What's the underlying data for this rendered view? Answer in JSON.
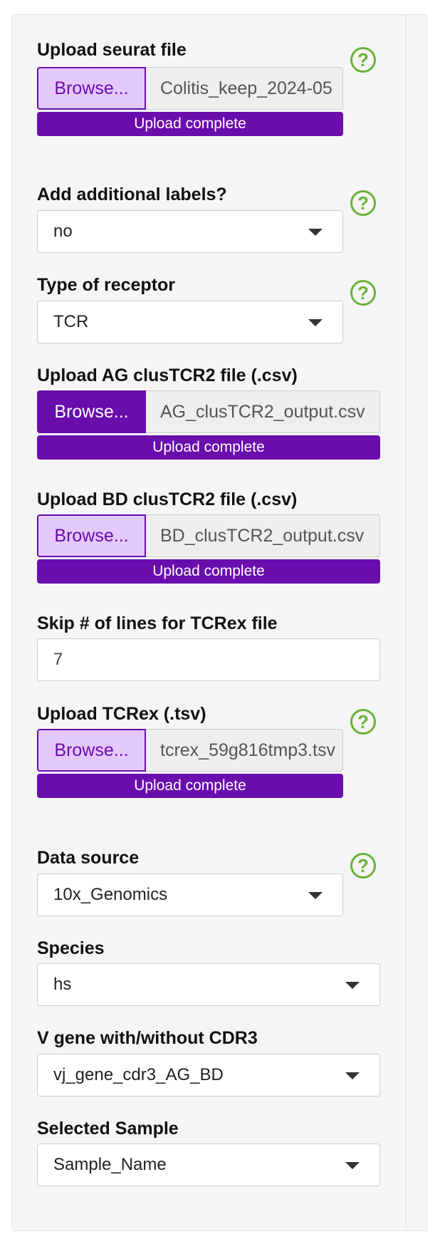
{
  "seurat": {
    "label": "Upload seurat file",
    "browse_label": "Browse...",
    "filename": "Colitis_keep_2024-05",
    "status": "Upload complete",
    "help": "?"
  },
  "additional_labels": {
    "label": "Add additional labels?",
    "value": "no",
    "help": "?"
  },
  "receptor_type": {
    "label": "Type of receptor",
    "value": "TCR",
    "help": "?"
  },
  "ag_clustcr2": {
    "label": "Upload AG clusTCR2 file (.csv)",
    "browse_label": "Browse...",
    "filename": "AG_clusTCR2_output.csv",
    "status": "Upload complete"
  },
  "bd_clustcr2": {
    "label": "Upload BD clusTCR2 file (.csv)",
    "browse_label": "Browse...",
    "filename": "BD_clusTCR2_output.csv",
    "status": "Upload complete"
  },
  "skip_lines": {
    "label": "Skip # of lines for TCRex file",
    "value": "7"
  },
  "tcrex": {
    "label": "Upload TCRex (.tsv)",
    "browse_label": "Browse...",
    "filename": "tcrex_59g816tmp3.tsv",
    "status": "Upload complete",
    "help": "?"
  },
  "data_source": {
    "label": "Data source",
    "value": "10x_Genomics",
    "help": "?"
  },
  "species": {
    "label": "Species",
    "value": "hs"
  },
  "v_gene": {
    "label": "V gene with/without CDR3",
    "value": "vj_gene_cdr3_AG_BD"
  },
  "selected_sample": {
    "label": "Selected Sample",
    "value": "Sample_Name"
  },
  "icons": {
    "help": "help-circle-icon",
    "dropdown": "caret-down-icon"
  },
  "colors": {
    "accent": "#6a0dad",
    "accent_light": "#e3c9fb",
    "help": "#6ab23a",
    "panel": "#f5f5f5"
  }
}
